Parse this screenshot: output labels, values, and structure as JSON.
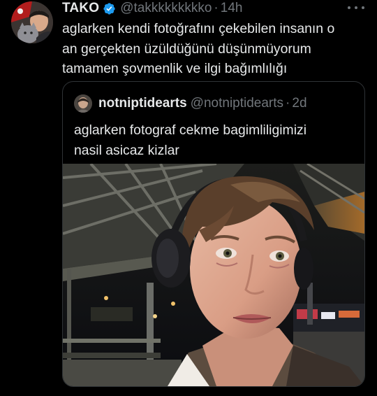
{
  "tweet": {
    "display_name": "TAKO",
    "handle": "@takkkkkkkkko",
    "separator": "·",
    "time": "14h",
    "text_lines": [
      "aglarken kendi fotoğrafını çekebilen insanın o",
      "an gerçekten üzüldüğünü düşünmüyorum",
      "tamamen şovmenlik ve ilgi bağımlılığı"
    ]
  },
  "quoted_tweet": {
    "display_name": "notniptidearts",
    "handle": "@notniptidearts",
    "separator": "·",
    "time": "2d",
    "text_lines": [
      "aglarken fotograf cekme bagimliligimizi",
      "nasil asicaz kizlar"
    ]
  },
  "colors": {
    "background": "#000000",
    "text_primary": "#e7e9ea",
    "text_secondary": "#71767b",
    "border": "#2f3336",
    "verified_blue": "#1d9bf0"
  },
  "icons": {
    "verified": "verified-badge-icon",
    "more": "more-options-icon"
  }
}
